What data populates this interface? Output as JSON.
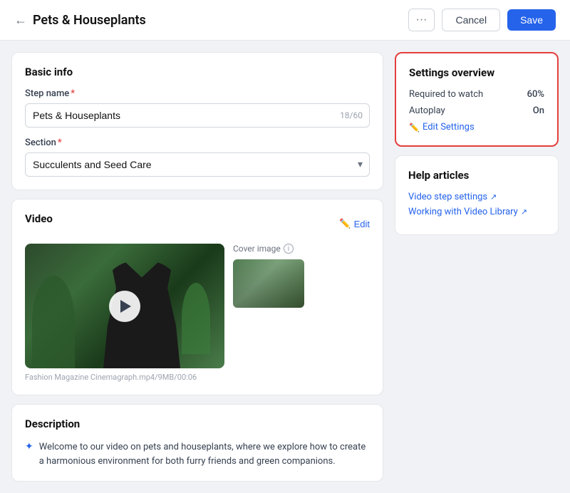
{
  "header": {
    "title": "Pets & Houseplants",
    "back_label": "←",
    "dots_label": "···",
    "cancel_label": "Cancel",
    "save_label": "Save"
  },
  "basic_info": {
    "section_title": "Basic info",
    "step_name_label": "Step name",
    "step_name_required": "*",
    "step_name_value": "Pets & Houseplants",
    "step_name_char_count": "18/60",
    "section_label": "Section",
    "section_required": "*",
    "section_value": "Succulents and Seed Care"
  },
  "video_section": {
    "section_title": "Video",
    "edit_label": "Edit",
    "video_caption": "Fashion Magazine Cinemagraph.mp4/9MB/00:06",
    "cover_image_label": "Cover image"
  },
  "description_section": {
    "section_title": "Description",
    "description_text": "Welcome to our video on pets and houseplants, where we explore how to create a harmonious environment for both furry friends and green companions."
  },
  "settings_overview": {
    "section_title": "Settings overview",
    "required_to_watch_label": "Required to watch",
    "required_to_watch_value": "60%",
    "autoplay_label": "Autoplay",
    "autoplay_value": "On",
    "edit_settings_label": "Edit Settings"
  },
  "help_articles": {
    "section_title": "Help articles",
    "article1_label": "Video step settings",
    "article2_label": "Working with Video Library"
  }
}
